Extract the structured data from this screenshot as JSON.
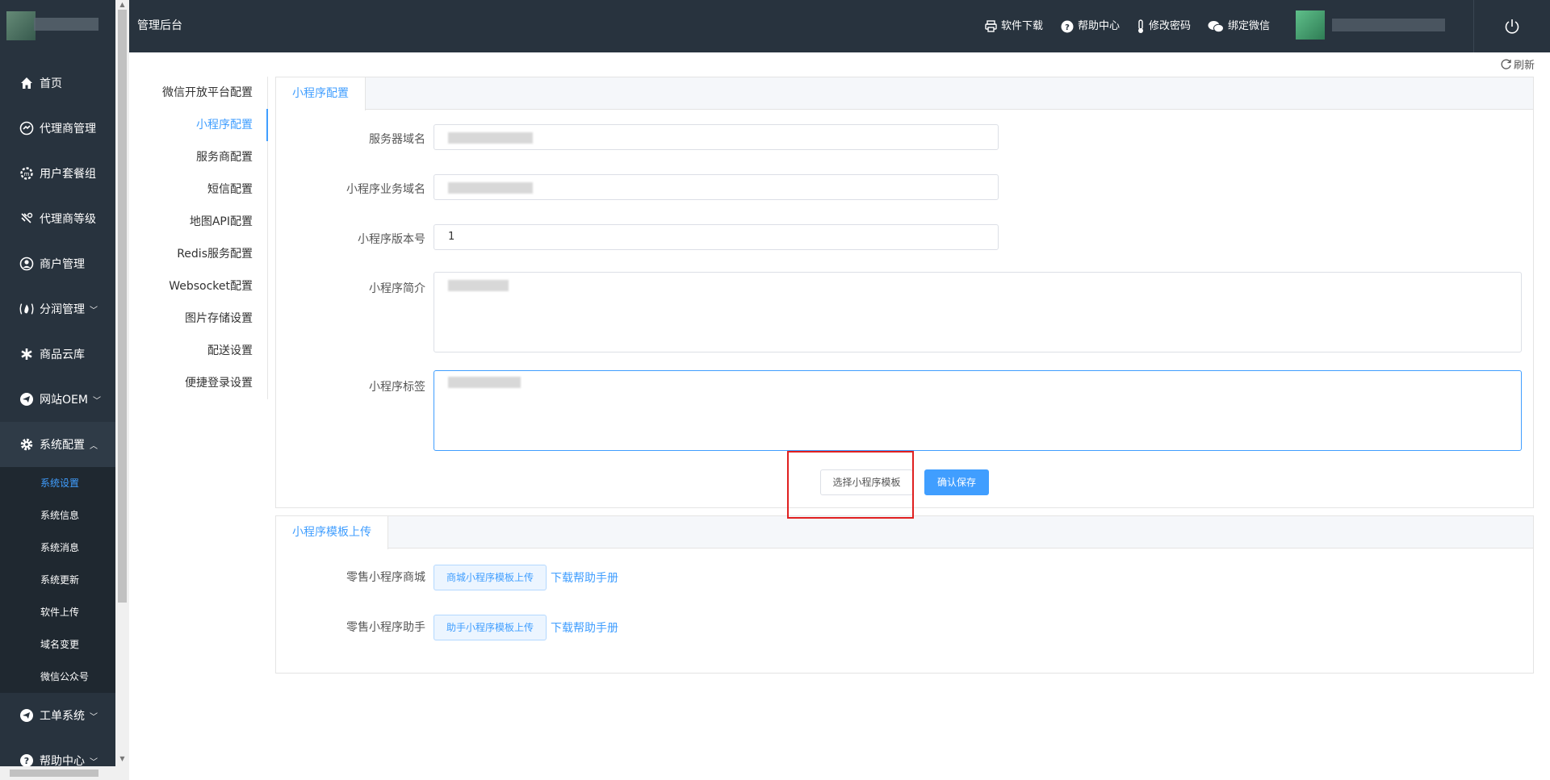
{
  "header": {
    "title": "管理后台",
    "links": [
      {
        "label": "软件下载",
        "icon": "printer-icon"
      },
      {
        "label": "帮助中心",
        "icon": "question-circle-icon"
      },
      {
        "label": "修改密码",
        "icon": "thermometer-icon"
      },
      {
        "label": "绑定微信",
        "icon": "wechat-icon"
      }
    ]
  },
  "sidebar": {
    "items": [
      {
        "label": "首页",
        "icon": "home-icon"
      },
      {
        "label": "代理商管理",
        "icon": "agent-icon"
      },
      {
        "label": "用户套餐组",
        "icon": "package-icon"
      },
      {
        "label": "代理商等级",
        "icon": "level-icon"
      },
      {
        "label": "商户管理",
        "icon": "user-circle-icon"
      },
      {
        "label": "分润管理",
        "icon": "fire-icon"
      },
      {
        "label": "商品云库",
        "icon": "asterisk-icon"
      },
      {
        "label": "网站OEM",
        "icon": "send-icon"
      },
      {
        "label": "系统配置",
        "icon": "gear-icon"
      }
    ],
    "sub_items": [
      "系统设置",
      "系统信息",
      "系统消息",
      "系统更新",
      "软件上传",
      "域名变更",
      "微信公众号"
    ],
    "bottom_items": [
      {
        "label": "工单系统",
        "icon": "send-icon"
      },
      {
        "label": "帮助中心",
        "icon": "question-circle-icon"
      }
    ]
  },
  "refresh_label": "刷新",
  "config_menu": [
    "微信开放平台配置",
    "小程序配置",
    "服务商配置",
    "短信配置",
    "地图API配置",
    "Redis服务配置",
    "Websocket配置",
    "图片存储设置",
    "配送设置",
    "便捷登录设置"
  ],
  "panel1": {
    "tab": "小程序配置",
    "fields": {
      "server_domain_label": "服务器域名",
      "business_domain_label": "小程序业务域名",
      "version_label": "小程序版本号",
      "version_value": "1",
      "intro_label": "小程序简介",
      "tags_label": "小程序标签"
    },
    "buttons": {
      "select_template": "选择小程序模板",
      "confirm_save": "确认保存"
    }
  },
  "panel2": {
    "tab": "小程序模板上传",
    "rows": [
      {
        "label": "零售小程序商城",
        "button": "商城小程序模板上传",
        "link": "下载帮助手册"
      },
      {
        "label": "零售小程序助手",
        "button": "助手小程序模板上传",
        "link": "下载帮助手册"
      }
    ]
  },
  "colors": {
    "sidebar_bg": "#28333e",
    "accent": "#409eff",
    "highlight": "#e02020"
  }
}
